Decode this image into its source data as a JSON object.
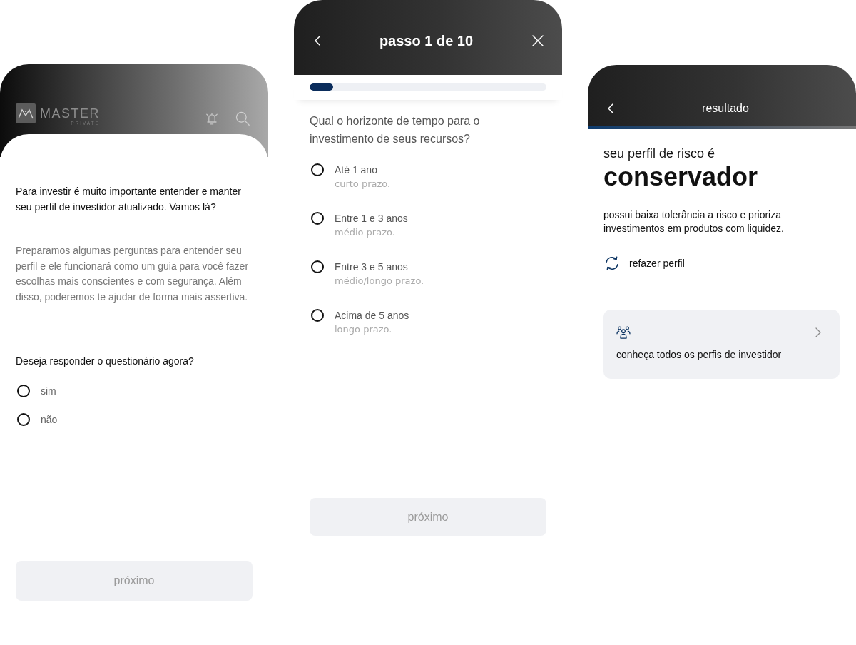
{
  "intro_screen": {
    "logo": {
      "name": "MASTER",
      "tagline": "PRIVATE"
    },
    "intro": "Para investir é muito importante entender e manter seu perfil de investidor atualizado. Vamos lá?",
    "description": "Preparamos algumas perguntas para entender seu perfil e ele funcionará como um guia para você fazer escolhas mais conscientes e com segurança. Além disso, poderemos te ajudar de forma mais assertiva.",
    "question": "Deseja responder o questionário agora?",
    "options": [
      {
        "label": "sim",
        "selected": false
      },
      {
        "label": "não",
        "selected": false
      }
    ],
    "button": {
      "label": "próximo",
      "disabled": true
    }
  },
  "question_screen": {
    "title": "passo 1 de 10",
    "progress": {
      "level": 0.1
    },
    "question": "Qual o horizonte de tempo para o investimento de seus recursos?",
    "options": [
      {
        "label": "Até 1 ano",
        "detail": "curto prazo.",
        "selected": false
      },
      {
        "label": "Entre 1 e 3 anos",
        "detail": "médio prazo.",
        "selected": false
      },
      {
        "label": "Entre 3 e 5 anos",
        "detail": "médio/longo prazo.",
        "selected": false
      },
      {
        "label": "Acima de 5 anos",
        "detail": "longo prazo.",
        "selected": false
      }
    ],
    "button": {
      "label": "próximo",
      "disabled": true
    }
  },
  "result_screen": {
    "title": "resultado",
    "subtitle": "seu perfil de risco é",
    "profile": "conservador",
    "description": "possui baixa tolerância a risco e prioriza investimentos em produtos com liquidez.",
    "redo_link": "refazer perfil",
    "card": {
      "label": "conheça todos os perfis de investidor"
    }
  }
}
